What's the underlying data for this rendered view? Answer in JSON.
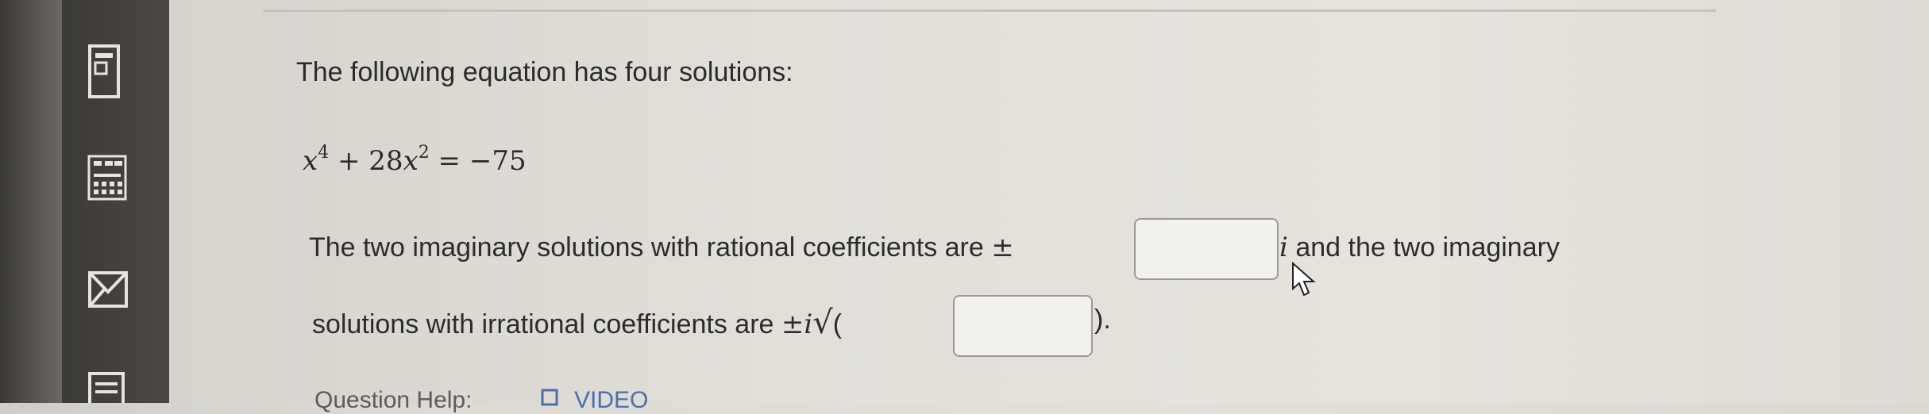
{
  "question": {
    "prompt": "The following equation has four solutions:",
    "equation": {
      "x": "x",
      "exp4": "4",
      "plus": " + 28",
      "x2": "x",
      "exp2": "2",
      "rhs": " = −75"
    },
    "line1_text": "The two imaginary solutions with rational coefficients are ",
    "pm": "±",
    "imag_unit": "i",
    "line1_after": " and the two imaginary",
    "line2_text": "solutions with irrational coefficients are ",
    "line2_pm_i": "±i",
    "sqrt_symbol": "√",
    "open_paren": "(",
    "close_paren": ").",
    "answer_box_1_value": "",
    "answer_box_2_value": ""
  },
  "help": {
    "label": "Question Help:",
    "video_label": "VIDEO"
  },
  "colors": {
    "rail": "#3c3a37",
    "content_bg": "#e2dfd9",
    "text": "#2b2b2b",
    "box_border": "#9b9a98",
    "link": "#4a6fb0"
  },
  "icons": [
    "page-icon",
    "calculator-icon",
    "mail-icon",
    "list-icon",
    "mouse-cursor-icon",
    "video-icon"
  ]
}
